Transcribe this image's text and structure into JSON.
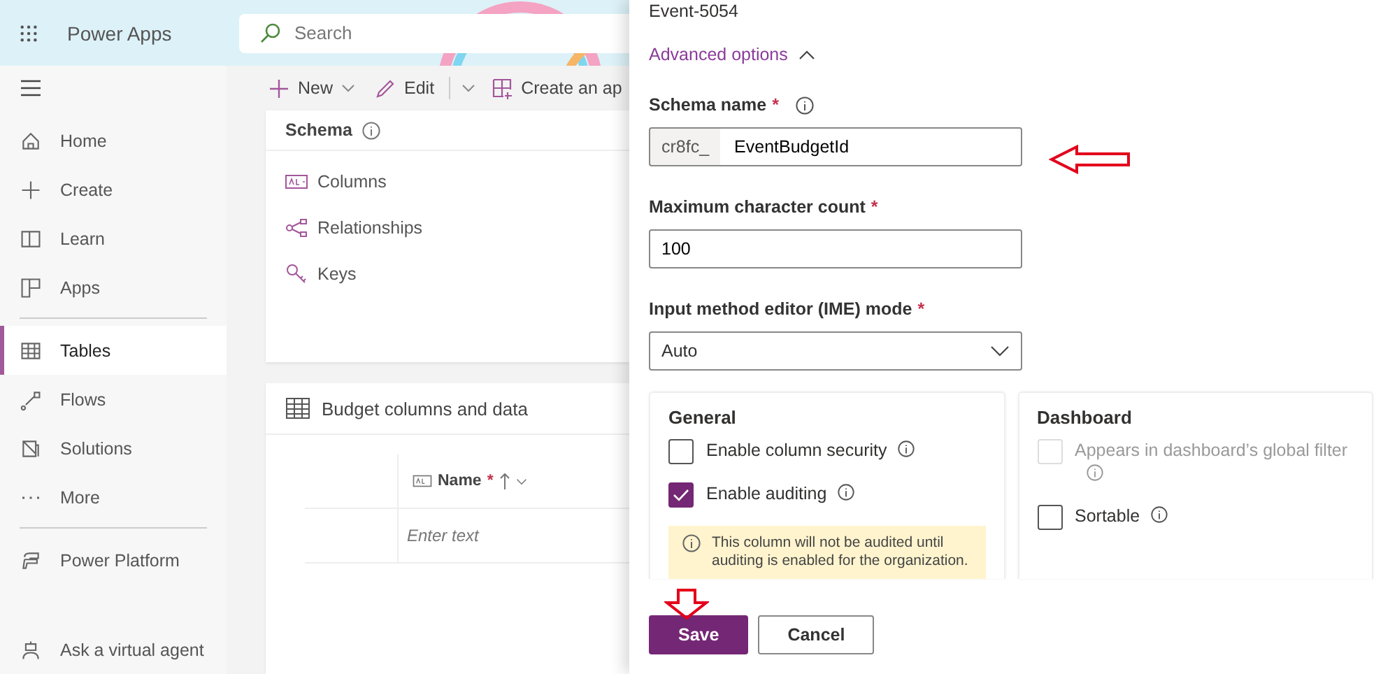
{
  "app": {
    "title": "Power Apps"
  },
  "search": {
    "placeholder": "Search"
  },
  "sidebar": {
    "sections": [
      [
        {
          "label": "Home",
          "selected": false
        },
        {
          "label": "Create",
          "selected": false
        },
        {
          "label": "Learn",
          "selected": false
        },
        {
          "label": "Apps",
          "selected": false
        }
      ],
      [
        {
          "label": "Tables",
          "selected": true
        },
        {
          "label": "Flows",
          "selected": false
        },
        {
          "label": "Solutions",
          "selected": false
        },
        {
          "label": "More",
          "selected": false
        }
      ],
      [
        {
          "label": "Power Platform",
          "selected": false
        }
      ]
    ],
    "bottom_item": {
      "label": "Ask a virtual agent",
      "selected": false
    }
  },
  "toolbar": [
    {
      "label": "New",
      "dropdown": true,
      "split": false
    },
    {
      "label": "Edit",
      "dropdown": true,
      "split": true
    },
    {
      "label": "Create an ap",
      "dropdown": false,
      "split": false
    }
  ],
  "schema": {
    "title": "Schema",
    "items": [
      "Columns",
      "Relationships",
      "Keys"
    ]
  },
  "budget": {
    "title": "Budget columns and data",
    "columns": [
      {
        "label": "Name",
        "required_mark": "*"
      }
    ],
    "rows": [
      {
        "placeholder": "Enter text"
      }
    ]
  },
  "panel": {
    "name_value": "Event-5054",
    "advanced": {
      "label": "Advanced options",
      "expanded": true
    },
    "fields": [
      {
        "kind": "prefixed",
        "label": "Schema name",
        "required_mark": "*",
        "info": true,
        "prefix": "cr8fc_",
        "value": "EventBudgetId"
      },
      {
        "kind": "text",
        "label": "Maximum character count",
        "required_mark": "*",
        "info": false,
        "value": "100"
      },
      {
        "kind": "select",
        "label": "Input method editor (IME) mode",
        "required_mark": "*",
        "info": false,
        "value": "Auto"
      }
    ],
    "sections": [
      {
        "title": "General",
        "options": [
          {
            "label": "Enable column security",
            "checked": false,
            "disabled": false
          },
          {
            "label": "Enable auditing",
            "checked": true,
            "disabled": false
          }
        ],
        "notice": "This column will not be audited until auditing is enabled for the organization."
      },
      {
        "title": "Dashboard",
        "options": [
          {
            "label": "Appears in dashboard’s global filter",
            "checked": false,
            "disabled": true
          },
          {
            "label": "Sortable",
            "checked": false,
            "disabled": false
          }
        ]
      }
    ],
    "buttons": [
      {
        "label": "Save",
        "kind": "primary"
      },
      {
        "label": "Cancel",
        "kind": "secondary"
      }
    ]
  }
}
